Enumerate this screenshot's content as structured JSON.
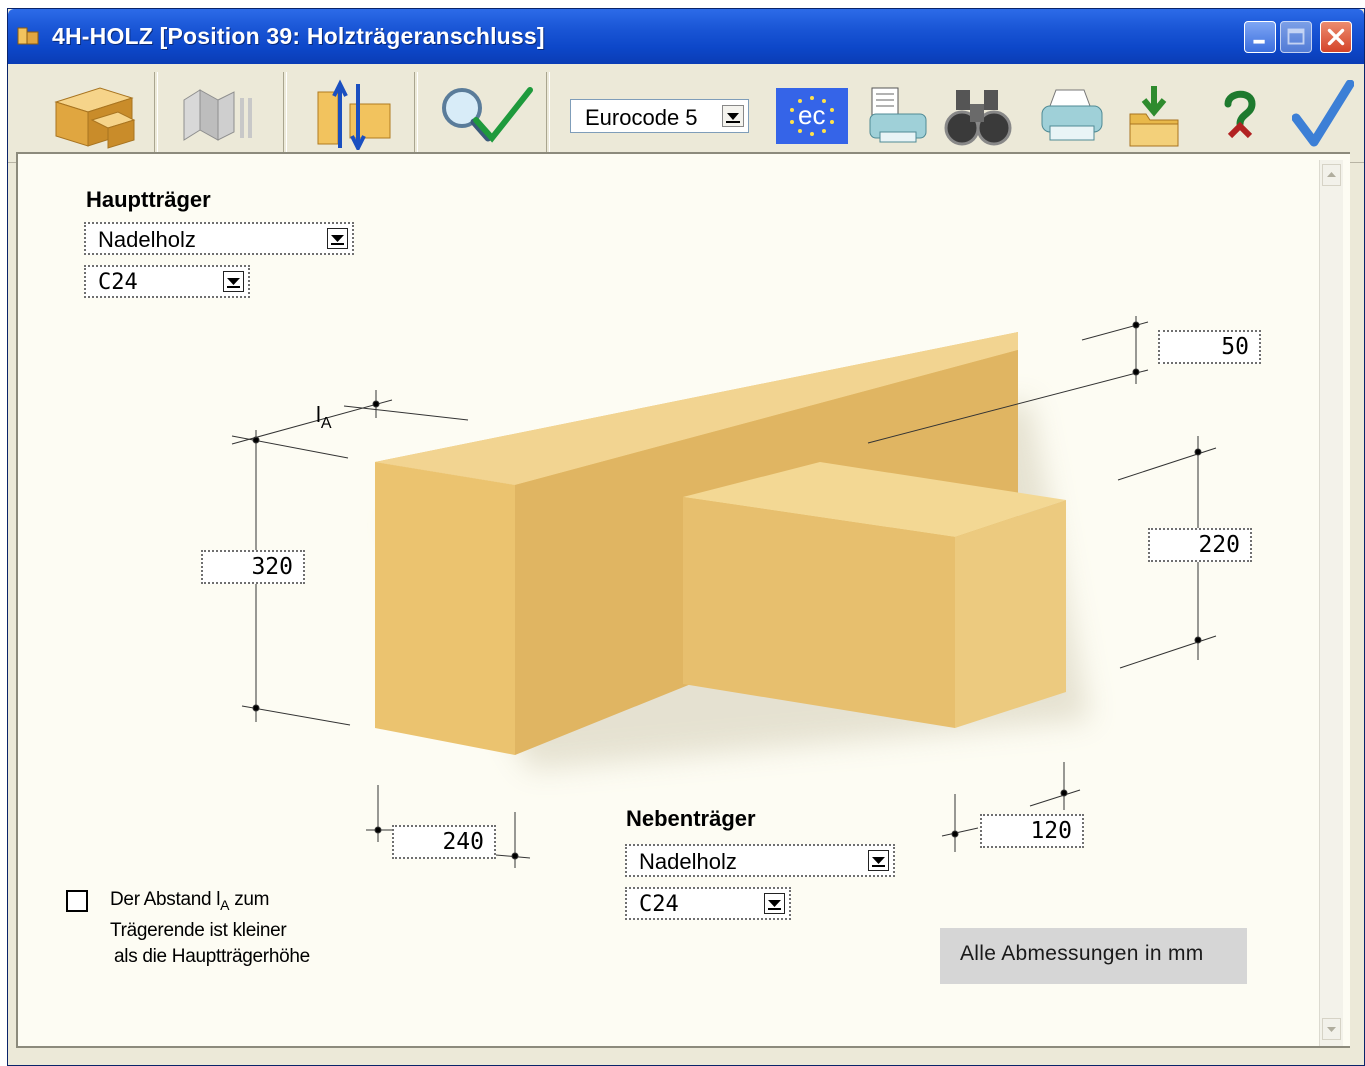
{
  "window": {
    "title": "4H-HOLZ [Position 39: Holzträgeranschluss]"
  },
  "toolbar": {
    "items": [
      {
        "icon": "beam-connection-icon"
      },
      {
        "icon": "beam-profile-icon"
      },
      {
        "icon": "arrows-up-down-icon"
      },
      {
        "icon": "check-magnifier-icon"
      },
      {
        "icon": "eurocode-logo-icon"
      },
      {
        "icon": "print-preview-icon"
      },
      {
        "icon": "binoculars-icon"
      },
      {
        "icon": "printer-icon"
      },
      {
        "icon": "save-folder-icon"
      },
      {
        "icon": "help-icon"
      },
      {
        "icon": "checkmark-ok-icon"
      }
    ],
    "code_select_value": "Eurocode 5",
    "eurocode_logo_text": "ec"
  },
  "main_beam": {
    "heading": "Hauptträger",
    "material": "Nadelholz",
    "grade": "C24"
  },
  "secondary_beam": {
    "heading": "Nebenträger",
    "material": "Nadelholz",
    "grade": "C24"
  },
  "dimensions": {
    "main_height": "320",
    "main_width": "240",
    "offset_top": "50",
    "secondary_height": "220",
    "secondary_width": "120",
    "la_label": "l",
    "la_sub": "A"
  },
  "checkbox": {
    "checked": false,
    "text_line1_pre": "Der Abstand l",
    "text_line1_sub": "A",
    "text_line1_post": " zum",
    "text_line2": "Trägerende ist kleiner",
    "text_line3": "als die Hauptträgerhöhe"
  },
  "units_note": "Alle Abmessungen in mm",
  "colors": {
    "titlebar": "#0d47c9",
    "wood_front": "#e9c070",
    "wood_top": "#f3d996",
    "wood_side": "#d9ad5c",
    "panel": "#fdfcf3"
  }
}
